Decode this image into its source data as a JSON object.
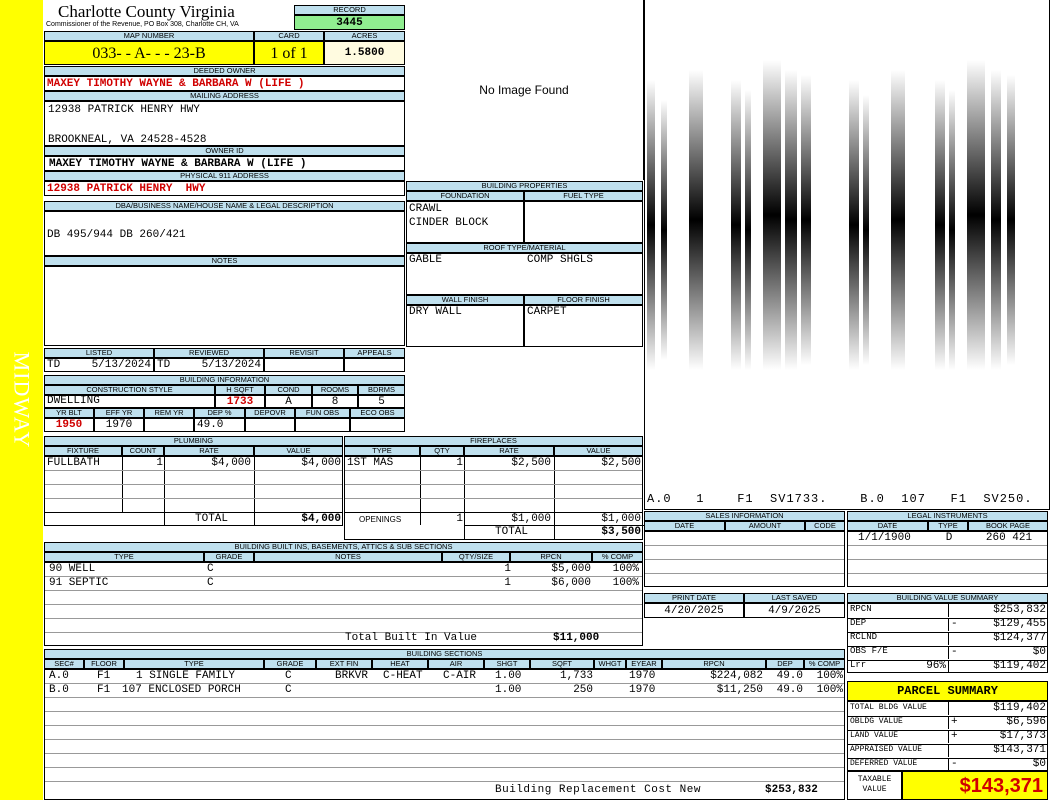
{
  "side_label": "MIDWAY",
  "header": {
    "county": "Charlotte County Virginia",
    "commissioner": "Commissioner of the Revenue, PO Box 308, Charlotte CH, VA",
    "record_label": "RECORD",
    "record": "3445",
    "map_number_label": "MAP NUMBER",
    "map_number": "033- - A- - - 23-B",
    "card_label": "CARD",
    "card": "1 of 1",
    "acres_label": "ACRES",
    "acres": "1.5800"
  },
  "owner": {
    "deeded_owner_label": "DEEDED OWNER",
    "deeded_owner": "MAXEY TIMOTHY WAYNE & BARBARA W (LIFE )",
    "mailing_label": "MAILING ADDRESS",
    "mailing_line1": "12938 PATRICK HENRY HWY",
    "mailing_line2": "",
    "mailing_line3": "BROOKNEAL, VA 24528-4528",
    "owner_id_label": "OWNER ID",
    "owner_id": "MAXEY TIMOTHY WAYNE & BARBARA W (LIFE )",
    "physical_label": "PHYSICAL 911 ADDRESS",
    "physical": "12938 PATRICK HENRY  HWY",
    "dba_label": "DBA/BUSINESS NAME/HOUSE NAME & LEGAL DESCRIPTION",
    "dba": "DB 495/944 DB 260/421",
    "notes_label": "NOTES"
  },
  "photo": {
    "no_image": "No Image Found"
  },
  "sketch": {
    "labels": [
      "A.0",
      "1",
      "F1",
      "SV1733.",
      "B.0",
      "107",
      "F1",
      "SV250."
    ]
  },
  "building_properties": {
    "title": "BUILDING PROPERTIES",
    "foundation_label": "FOUNDATION",
    "fuel_label": "FUEL TYPE",
    "foundation1": "CRAWL",
    "foundation2": "CINDER BLOCK",
    "roof_label": "ROOF TYPE/MATERIAL",
    "roof1": "GABLE",
    "roof2": "COMP SHGLS",
    "wall_label": "WALL FINISH",
    "floor_label": "FLOOR FINISH",
    "wall": "DRY WALL",
    "floor": "CARPET"
  },
  "status": {
    "listed_label": "LISTED",
    "reviewed_label": "REVIEWED",
    "revisit_label": "REVISIT",
    "appeals_label": "APPEALS",
    "listed_by": "TD",
    "listed_date": "5/13/2024",
    "reviewed_by": "TD",
    "reviewed_date": "5/13/2024"
  },
  "building_info": {
    "title": "BUILDING INFORMATION",
    "construction_label": "CONSTRUCTION STYLE",
    "hsqft_label": "H SQFT",
    "cond_label": "COND",
    "rooms_label": "ROOMS",
    "bdrms_label": "BDRMS",
    "construction": "DWELLING",
    "hsqft": "1733",
    "cond": "A",
    "rooms": "8",
    "bdrms": "5",
    "yrblt_label": "YR BLT",
    "effyr_label": "EFF YR",
    "remyr_label": "REM YR",
    "dep_label": "DEP %",
    "depovr_label": "DEPOVR",
    "funobs_label": "FUN OBS",
    "ecoobs_label": "ECO OBS",
    "yrblt": "1950",
    "effyr": "1970",
    "dep": "49.0"
  },
  "plumbing": {
    "title": "PLUMBING",
    "headers": [
      "FIXTURE",
      "COUNT",
      "RATE",
      "VALUE"
    ],
    "rows": [
      {
        "fixture": "FULLBATH",
        "count": "1",
        "rate": "$4,000",
        "value": "$4,000"
      }
    ],
    "total_label": "TOTAL",
    "total": "$4,000"
  },
  "fireplaces": {
    "title": "FIREPLACES",
    "headers": [
      "TYPE",
      "QTY",
      "RATE",
      "VALUE"
    ],
    "rows": [
      {
        "type": "1ST MAS",
        "qty": "1",
        "rate": "$2,500",
        "value": "$2,500"
      }
    ],
    "openings_label": "OPENINGS",
    "openings_qty": "1",
    "openings_rate": "$1,000",
    "openings_value": "$1,000",
    "total_label": "TOTAL",
    "total": "$3,500"
  },
  "built_ins": {
    "title": "BUILDING BUILT INS, BASEMENTS, ATTICS & SUB SECTIONS",
    "headers": [
      "TYPE",
      "GRADE",
      "NOTES",
      "QTY/SIZE",
      "RPCN",
      "% COMP"
    ],
    "rows": [
      {
        "type": "90 WELL",
        "grade": "C",
        "qty": "1",
        "rpcn": "$5,000",
        "comp": "100%"
      },
      {
        "type": "91 SEPTIC",
        "grade": "C",
        "qty": "1",
        "rpcn": "$6,000",
        "comp": "100%"
      }
    ],
    "total_label": "Total Built In Value",
    "total": "$11,000"
  },
  "sales": {
    "title": "SALES INFORMATION",
    "headers": [
      "DATE",
      "AMOUNT",
      "CODE"
    ]
  },
  "legal": {
    "title": "LEGAL INSTRUMENTS",
    "headers": [
      "DATE",
      "TYPE",
      "BOOK PAGE"
    ],
    "rows": [
      {
        "date": "1/1/1900",
        "type": "D",
        "book": "260 421"
      }
    ]
  },
  "dates": {
    "print_label": "PRINT DATE",
    "saved_label": "LAST SAVED",
    "print": "4/20/2025",
    "saved": "4/9/2025"
  },
  "value_summary": {
    "title": "BUILDING VALUE SUMMARY",
    "rows": [
      {
        "label": "RPCN",
        "sign": "",
        "value": "$253,832"
      },
      {
        "label": "DEP",
        "sign": "-",
        "value": "$129,455"
      },
      {
        "label": "RCLND",
        "sign": "",
        "value": "$124,377"
      },
      {
        "label": "OBS F/E",
        "sign": "-",
        "value": "$0"
      },
      {
        "label": "Lrr",
        "sign": "96%",
        "value": "$119,402"
      }
    ]
  },
  "parcel_summary": {
    "title": "PARCEL SUMMARY",
    "rows": [
      {
        "label": "TOTAL BLDG VALUE",
        "sign": "",
        "value": "$119,402"
      },
      {
        "label": "OBLDG VALUE",
        "sign": "+",
        "value": "$6,596"
      },
      {
        "label": "LAND VALUE",
        "sign": "+",
        "value": "$17,373"
      },
      {
        "label": "APPRAISED VALUE",
        "sign": "",
        "value": "$143,371"
      },
      {
        "label": "DEFERRED VALUE",
        "sign": "-",
        "value": "$0"
      }
    ],
    "taxable_label1": "TAXABLE",
    "taxable_label2": "VALUE",
    "taxable": "$143,371"
  },
  "sections": {
    "title": "BUILDING SECTIONS",
    "headers": [
      "SEC#",
      "FLOOR",
      "TYPE",
      "GRADE",
      "EXT FIN",
      "HEAT",
      "AIR",
      "SHGT",
      "SQFT",
      "WHGT",
      "EYEAR",
      "RPCN",
      "DEP",
      "% COMP"
    ],
    "rows": [
      {
        "sec": "A.0",
        "floor": "F1",
        "type": "1 SINGLE FAMILY",
        "grade": "C",
        "ext": "BRKVR",
        "heat": "C-HEAT",
        "air": "C-AIR",
        "shgt": "1.00",
        "sqft": "1,733",
        "whgt": "",
        "eyear": "1970",
        "rpcn": "$224,082",
        "dep": "49.0",
        "comp": "100%"
      },
      {
        "sec": "B.0",
        "floor": "F1",
        "type": "107 ENCLOSED PORCH",
        "grade": "C",
        "ext": "",
        "heat": "",
        "air": "",
        "shgt": "1.00",
        "sqft": "250",
        "whgt": "",
        "eyear": "1970",
        "rpcn": "$11,250",
        "dep": "49.0",
        "comp": "100%"
      }
    ],
    "total_label": "Building Replacement Cost New",
    "total": "$253,832"
  },
  "colors": {
    "yellow": "#ffff00",
    "header_blue": "#bfe0ee",
    "record_green": "#90ee90",
    "acres_bg": "#fffbe0",
    "red": "#d00000"
  }
}
